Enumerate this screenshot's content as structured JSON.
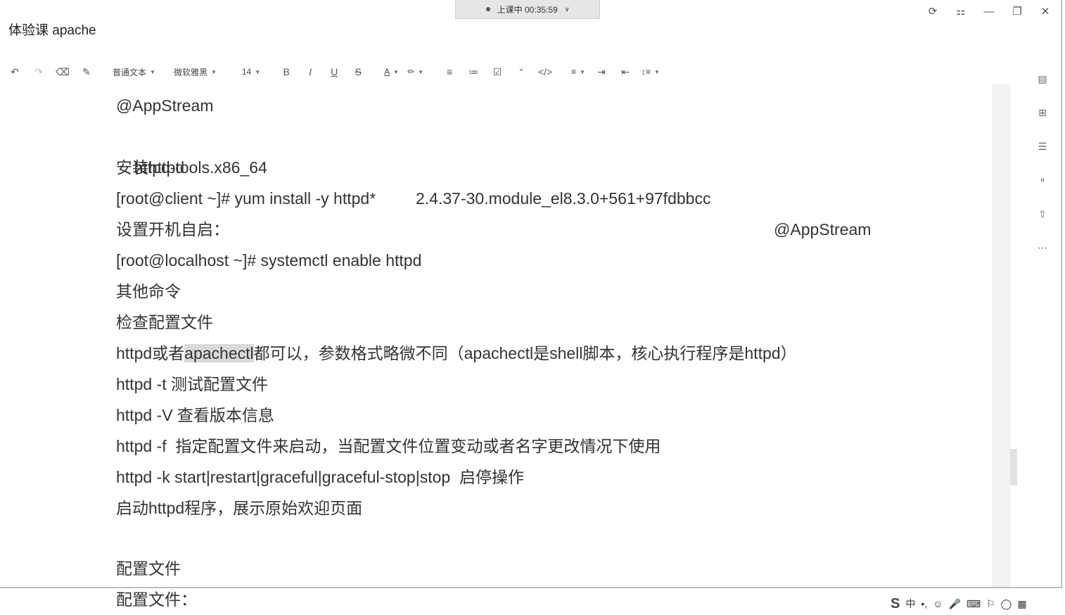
{
  "window": {
    "title": "体验课 apache",
    "class_timer": "上课中 00:35:59",
    "controls": [
      "refresh-icon",
      "pin-icon",
      "minimize-icon",
      "maximize-icon",
      "close-icon"
    ]
  },
  "toolbar": {
    "paragraph_style": "普通文本",
    "font_family": "微软雅黑",
    "font_size": "14",
    "bold": "B",
    "italic": "I",
    "underline": "U",
    "strike": "S",
    "font_color": "A"
  },
  "document": {
    "lines": [
      {
        "text": "@AppStream"
      },
      {
        "text": "httpd-tools.x86_64",
        "col2": "2.4.37-30.module_el8.3.0+561+97fdbbcc",
        "col3": "@AppStream"
      },
      {
        "text": "安装httpd"
      },
      {
        "text": "[root@client ~]# yum install -y httpd*"
      },
      {
        "text": "设置开机自启："
      },
      {
        "text": "[root@localhost ~]# systemctl enable httpd"
      },
      {
        "text": "其他命令"
      },
      {
        "text": "检查配置文件"
      },
      {
        "pre": "httpd或者",
        "hl": "apachectl",
        "post": "都可以，参数格式略微不同（apachectl是shell脚本，核心执行程序是httpd）"
      },
      {
        "text": "httpd -t 测试配置文件"
      },
      {
        "text": "httpd -V 查看版本信息"
      },
      {
        "text": "httpd -f  指定配置文件来启动，当配置文件位置变动或者名字更改情况下使用"
      },
      {
        "text": "httpd -k start|restart|graceful|graceful-stop|stop  启停操作"
      },
      {
        "text": "启动httpd程序，展示原始欢迎页面"
      },
      {
        "text": ""
      },
      {
        "text": "配置文件"
      },
      {
        "text": "配置文件："
      }
    ]
  },
  "ime": {
    "mode": "中",
    "punct": "•,"
  }
}
